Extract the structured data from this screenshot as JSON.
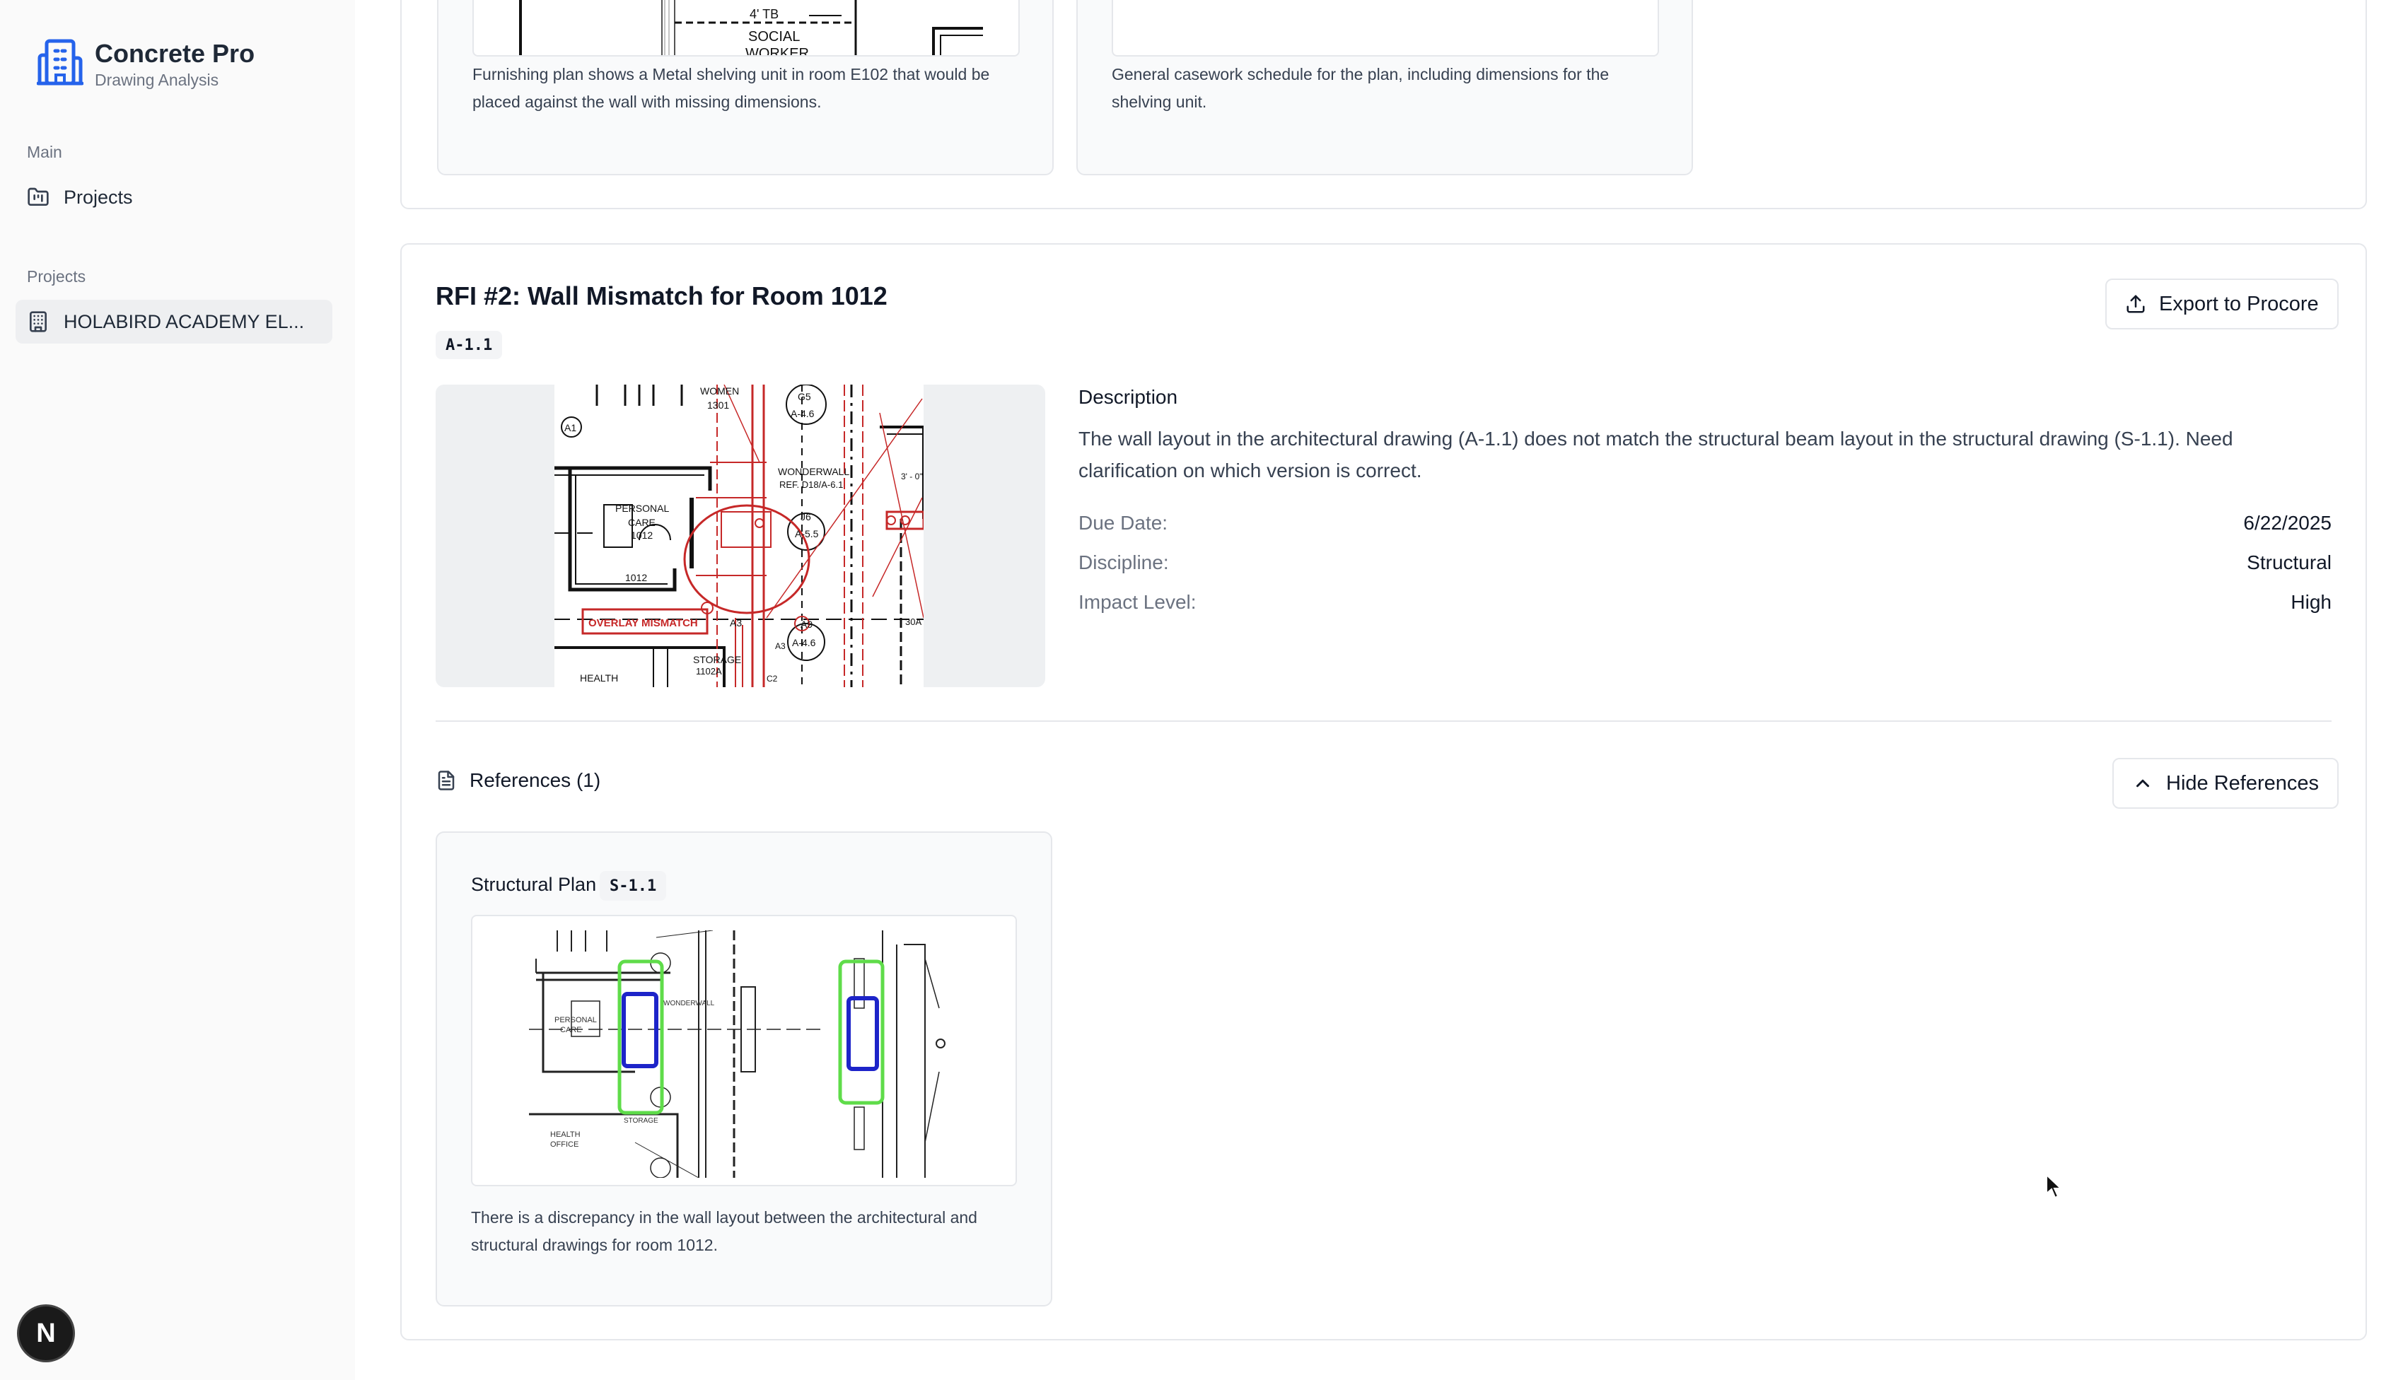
{
  "app": {
    "title": "Concrete Pro",
    "subtitle": "Drawing Analysis"
  },
  "sidebar": {
    "main_label": "Main",
    "main_items": [
      {
        "label": "Projects",
        "icon": "folder-kanban-icon"
      }
    ],
    "projects_label": "Projects",
    "project_items": [
      {
        "label": "HOLABIRD ACADEMY EL...",
        "icon": "building-icon",
        "active": true
      }
    ],
    "avatar_letter": "N"
  },
  "rfi1": {
    "ref_captions": [
      "Furnishing plan shows a Metal shelving unit in room E102 that would be placed against the wall with missing dimensions.",
      "General casework schedule for the plan, including dimensions for the shelving unit."
    ],
    "drawing_labels": {
      "dimension": "4' TB",
      "room": "SOCIAL",
      "room2": "WORKER"
    }
  },
  "rfi2": {
    "title": "RFI #2: Wall Mismatch for Room 1012",
    "sheet": "A-1.1",
    "export_label": "Export to Procore",
    "description_heading": "Description",
    "description": "The wall layout in the architectural drawing (A-1.1) does not match the structural beam layout in the structural drawing (S-1.1). Need clarification on which version is correct.",
    "fields": [
      {
        "key": "Due Date:",
        "value": "6/22/2025"
      },
      {
        "key": "Discipline:",
        "value": "Structural"
      },
      {
        "key": "Impact Level:",
        "value": "High"
      }
    ],
    "drawing_labels": {
      "women": "WOMEN",
      "women_no": "1301",
      "g5": "G5",
      "a46": "A-4.6",
      "a1": "A1",
      "wonderwall": "WONDERWALL",
      "wonderwall_ref": "REF. D18/A-6.1",
      "personal": "PERSONAL",
      "care": "CARE",
      "room_no": "1012",
      "room_no2": "1012",
      "j6": "J6",
      "a55": "A-5.5",
      "dim": "3' - 0\"",
      "overlay": "OVERLAY MISMATCH",
      "a3": "A3",
      "a9": "A9",
      "a46b": "A-4.6",
      "a3b": "A3",
      "storage": "STORAGE",
      "storage_no": "1102A",
      "health": "HEALTH",
      "a30": "30A",
      "c2": "C2"
    },
    "references_label": "References (1)",
    "hide_label": "Hide References",
    "references": [
      {
        "title": "Structural Plan",
        "sheet": "S-1.1",
        "caption": "There is a discrepancy in the wall layout between the architectural and structural drawings for room 1012.",
        "drawing_labels": {
          "personal": "PERSONAL",
          "care": "CARE",
          "wonderwall": "WONDERWALL",
          "health": "HEALTH",
          "office": "OFFICE",
          "storage": "STORAGE"
        }
      }
    ]
  },
  "colors": {
    "accent": "#2563eb",
    "overlay_red": "#c62828",
    "highlight_green": "#5fdc4a",
    "highlight_blue": "#1d24c9"
  }
}
